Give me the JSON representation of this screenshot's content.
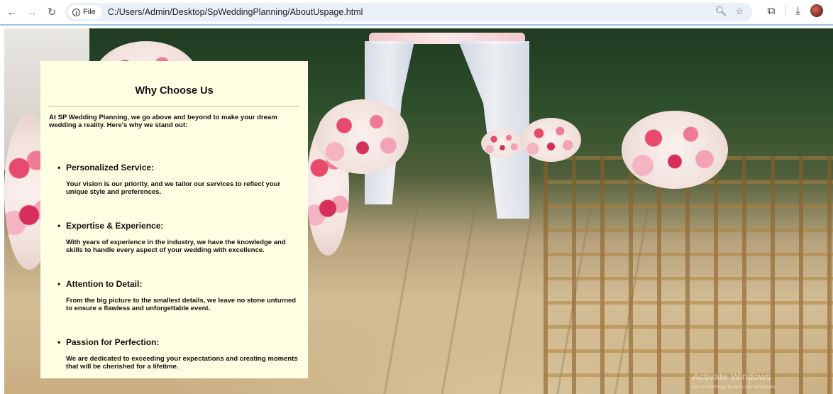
{
  "browser": {
    "file_label": "File",
    "url": "C:/Users/Admin/Desktop/SpWeddingPlanning/AboutUspage.html",
    "icons": [
      "back-icon",
      "forward-icon",
      "reload-icon",
      "info-icon",
      "zoom-icon",
      "star-icon",
      "extensions-icon",
      "download-icon",
      "profile-avatar"
    ]
  },
  "page": {
    "title": "Why Choose Us",
    "intro": "At SP Wedding Planning, we go above and beyond to make your dream wedding a reality. Here's why we stand out:",
    "items": [
      {
        "title": "Personalized Service:",
        "desc": "Your vision is our priority, and we tailor our services to reflect your unique style and preferences."
      },
      {
        "title": "Expertise & Experience:",
        "desc": "With years of experience in the industry, we have the knowledge and skills to handle every aspect of your wedding with excellence."
      },
      {
        "title": "Attention to Detail:",
        "desc": "From the big picture to the smallest details, we leave no stone unturned to ensure a flawless and unforgettable event."
      },
      {
        "title": "Passion for Perfection:",
        "desc": "We are dedicated to exceeding your expectations and creating moments that will be cherished for a lifetime."
      }
    ]
  },
  "watermark": {
    "title": "Activate Windows",
    "subtitle": "Go to Settings to activate Windows."
  },
  "colors": {
    "card_background": "#ffffe3",
    "omnibox": "#e9f0f7"
  }
}
